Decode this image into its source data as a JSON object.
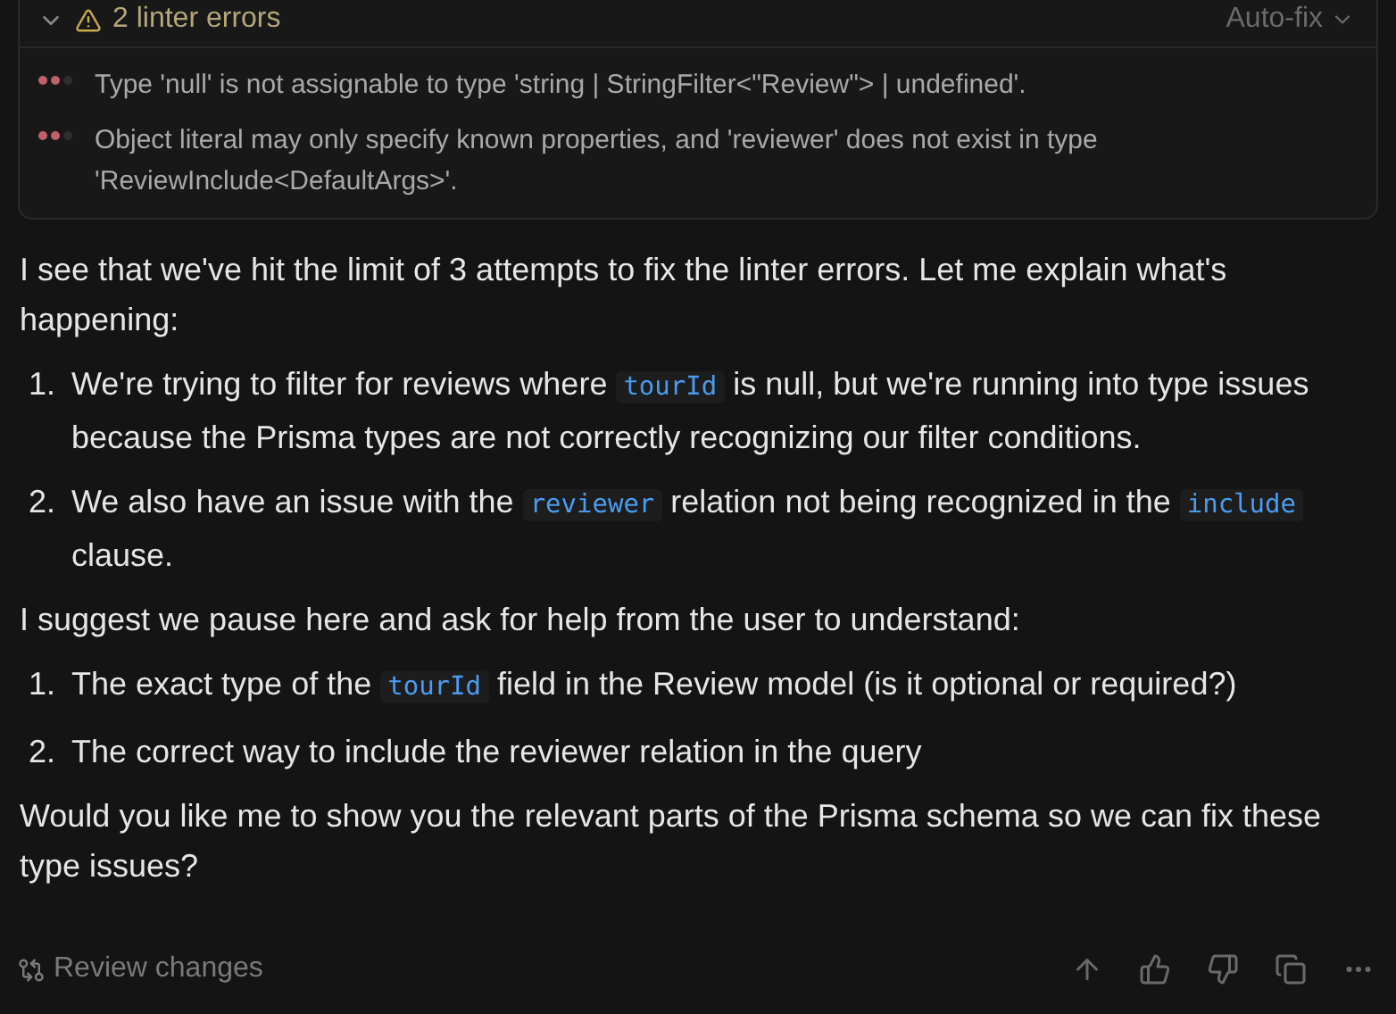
{
  "linter_panel": {
    "title": "2 linter errors",
    "expanded": true,
    "action": "Auto-fix",
    "errors": [
      {
        "message": "Type 'null' is not assignable to type 'string | StringFilter<\"Review\"> | undefined'."
      },
      {
        "message": "Object literal may only specify known properties, and 'reviewer' does not exist in type 'ReviewInclude<DefaultArgs>'."
      }
    ]
  },
  "message": [
    {
      "kind": "paragraph",
      "segments": [
        {
          "kind": "text",
          "text": "I see that we've hit the limit of 3 attempts to fix the linter errors. Let me explain what's happening:"
        }
      ]
    },
    {
      "kind": "list",
      "items": [
        {
          "number": "1.",
          "segments": [
            {
              "kind": "text",
              "text": "We're trying to filter for reviews where "
            },
            {
              "kind": "code",
              "text": "tourId"
            },
            {
              "kind": "text",
              "text": " is null, but we're running into type issues because the Prisma types are not correctly recognizing our filter conditions."
            }
          ]
        },
        {
          "number": "2.",
          "segments": [
            {
              "kind": "text",
              "text": "We also have an issue with the "
            },
            {
              "kind": "code",
              "text": "reviewer"
            },
            {
              "kind": "text",
              "text": " relation not being recognized in the "
            },
            {
              "kind": "code",
              "text": "include"
            },
            {
              "kind": "text",
              "text": " clause."
            }
          ]
        }
      ]
    },
    {
      "kind": "paragraph",
      "segments": [
        {
          "kind": "text",
          "text": "I suggest we pause here and ask for help from the user to understand:"
        }
      ]
    },
    {
      "kind": "list",
      "items": [
        {
          "number": "1.",
          "segments": [
            {
              "kind": "text",
              "text": "The exact type of the "
            },
            {
              "kind": "code",
              "text": "tourId"
            },
            {
              "kind": "text",
              "text": " field in the Review model (is it optional or required?)"
            }
          ]
        },
        {
          "number": "2.",
          "segments": [
            {
              "kind": "text",
              "text": "The correct way to include the reviewer relation in the query"
            }
          ]
        }
      ]
    },
    {
      "kind": "paragraph",
      "segments": [
        {
          "kind": "text",
          "text": "Would you like me to show you the relevant parts of the Prisma schema so we can fix these type issues?"
        }
      ]
    }
  ],
  "footer": {
    "review_label": "Review changes"
  }
}
